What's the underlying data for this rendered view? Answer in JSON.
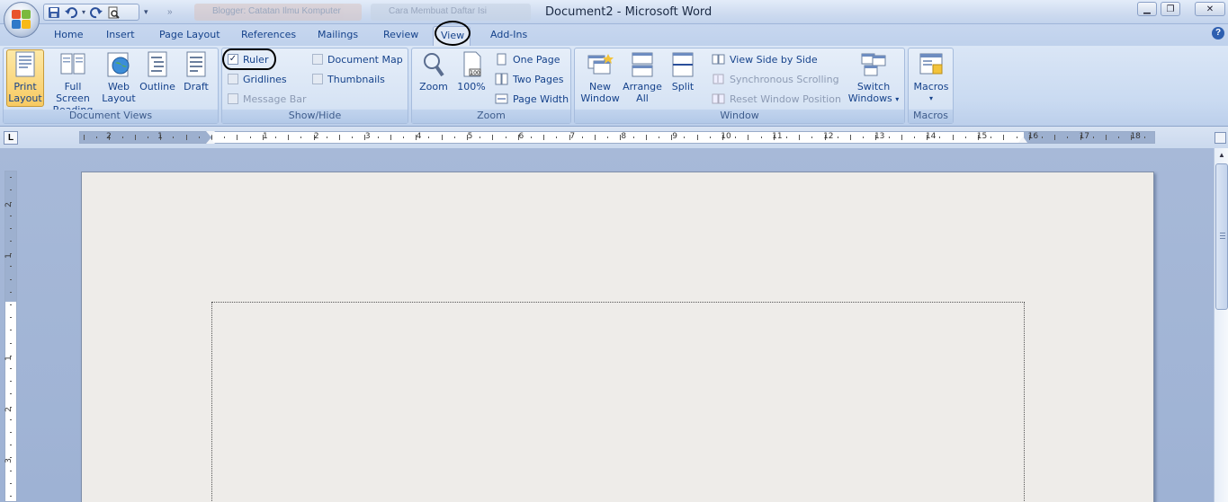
{
  "window": {
    "title": "Document2 - Microsoft Word",
    "faded_tabs": [
      "Blogger: Catatan Ilmu Komputer",
      "Cara Membuat Daftar Isi"
    ]
  },
  "tabs": [
    "Home",
    "Insert",
    "Page Layout",
    "References",
    "Mailings",
    "Review",
    "View",
    "Add-Ins"
  ],
  "active_tab": "View",
  "ribbon": {
    "document_views": {
      "label": "Document Views",
      "buttons": [
        {
          "line1": "Print",
          "line2": "Layout",
          "active": true,
          "icon": "print-layout-icon"
        },
        {
          "line1": "Full Screen",
          "line2": "Reading",
          "active": false,
          "icon": "full-screen-reading-icon"
        },
        {
          "line1": "Web",
          "line2": "Layout",
          "active": false,
          "icon": "web-layout-icon"
        },
        {
          "line1": "Outline",
          "line2": "",
          "active": false,
          "icon": "outline-icon"
        },
        {
          "line1": "Draft",
          "line2": "",
          "active": false,
          "icon": "draft-icon"
        }
      ]
    },
    "show_hide": {
      "label": "Show/Hide",
      "ruler": {
        "label": "Ruler",
        "checked": true
      },
      "gridlines": {
        "label": "Gridlines",
        "checked": false
      },
      "message_bar": {
        "label": "Message Bar",
        "checked": false,
        "disabled": true
      },
      "document_map": {
        "label": "Document Map",
        "checked": false
      },
      "thumbnails": {
        "label": "Thumbnails",
        "checked": false
      }
    },
    "zoom": {
      "label": "Zoom",
      "zoom_btn": "Zoom",
      "hundred_btn": "100%",
      "one_page": "One Page",
      "two_pages": "Two Pages",
      "page_width": "Page Width"
    },
    "window": {
      "label": "Window",
      "new_window": {
        "line1": "New",
        "line2": "Window"
      },
      "arrange_all": {
        "line1": "Arrange",
        "line2": "All"
      },
      "split": "Split",
      "view_side_by_side": "View Side by Side",
      "synchronous_scrolling": "Synchronous Scrolling",
      "reset_window_position": "Reset Window Position",
      "switch_windows": {
        "line1": "Switch",
        "line2": "Windows"
      }
    },
    "macros": {
      "label": "Macros",
      "button": "Macros"
    }
  },
  "ruler": {
    "left_margin_labels": [
      "2",
      "1"
    ],
    "labels": [
      "1",
      "2",
      "3",
      "4",
      "5",
      "6",
      "7",
      "8",
      "9",
      "10",
      "11",
      "12",
      "13",
      "14",
      "15",
      "16",
      "17",
      "18"
    ],
    "vertical_labels": [
      "2",
      "1",
      "1",
      "2",
      "3"
    ]
  },
  "colors": {
    "accent": "#15428b",
    "ribbon_bg": "#d6e3f4",
    "active_button": "#f8ca62",
    "page": "#eeece9"
  }
}
